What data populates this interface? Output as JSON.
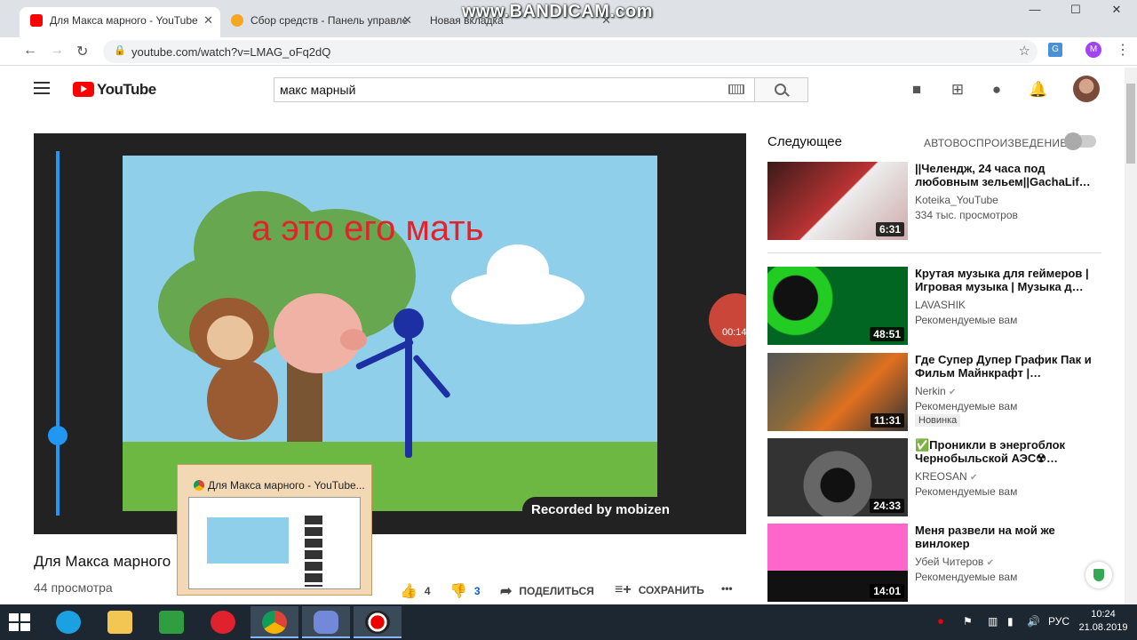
{
  "browser": {
    "tabs": [
      {
        "title": "Для Макса марного - YouTube",
        "active": true
      },
      {
        "title": "Сбор средств - Панель управле",
        "active": false
      },
      {
        "title": "Новая вкладка",
        "active": false
      }
    ],
    "url": "youtube.com/watch?v=LMAG_oFq2dQ",
    "watermark": "www.BANDICAM.com",
    "profile_initial": "M"
  },
  "youtube": {
    "logo_text": "YouTube",
    "search_value": "макс марный",
    "video": {
      "caption": "а это его мать",
      "recorded_by": "Recorded by mobizen",
      "mobizen_timer": "00:14",
      "seek_fraction": 0.78,
      "title": "Для Макса марного",
      "views": "44 просмотра",
      "likes": "4",
      "dislikes": "3",
      "share_label": "ПОДЕЛИТЬСЯ",
      "save_label": "СОХРАНИТЬ",
      "more_label": "•••"
    },
    "sidebar": {
      "next_label": "Следующее",
      "autoplay_label": "АВТОВОСПРОИЗВЕДЕНИЕ",
      "items": [
        {
          "title": "||Челендж, 24 часа под любовным зельем||GachaLif…",
          "channel": "Koteika_YouTube",
          "meta": "334 тыс. просмотров",
          "duration": "6:31",
          "verified": false
        },
        {
          "title": "Крутая музыка для геймеров | Игровая музыка | Музыка д…",
          "channel": "LAVASHIK",
          "meta": "Рекомендуемые вам",
          "duration": "48:51",
          "verified": false
        },
        {
          "title": "Где Супер Дупер График Пак и Фильм Майнкрафт |…",
          "channel": "Nerkin",
          "meta": "Рекомендуемые вам",
          "duration": "11:31",
          "verified": true,
          "badge": "Новинка"
        },
        {
          "title": "✅Проникли в энергоблок Чернобыльской АЭС☢…",
          "channel": "KREOSAN",
          "meta": "Рекомендуемые вам",
          "duration": "24:33",
          "verified": true
        },
        {
          "title": "Меня развели на мой же винлокер",
          "channel": "Убей Читеров",
          "meta": "Рекомендуемые вам",
          "duration": "14:01",
          "verified": true
        }
      ]
    }
  },
  "preview_popup": {
    "title": "Для Макса марного - YouTube..."
  },
  "taskbar": {
    "language": "РУС",
    "time": "10:24",
    "date": "21.08.2019"
  },
  "colors": {
    "yt_red": "#ff0000",
    "taskbar": "#1d2731",
    "seek_blue": "#2196f3"
  }
}
